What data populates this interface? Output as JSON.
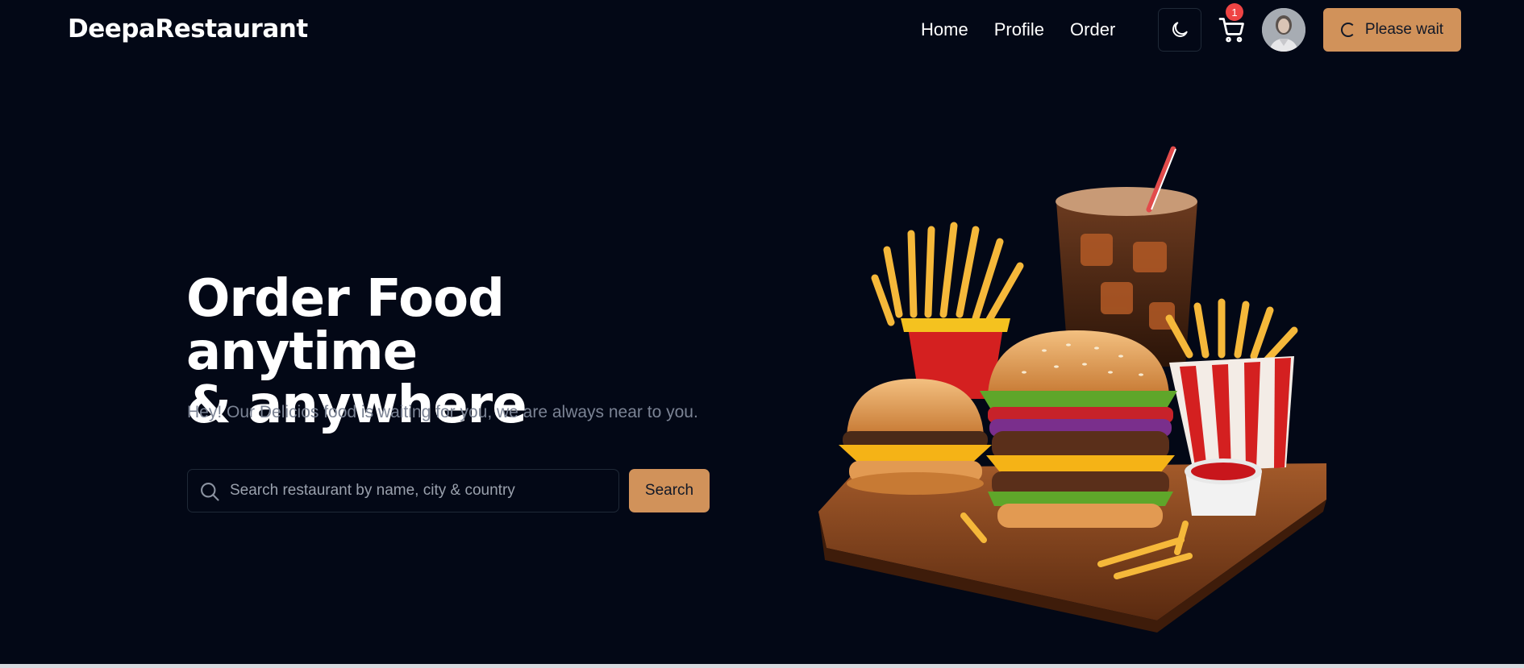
{
  "brand": {
    "name": "DeepaRestaurant"
  },
  "nav": {
    "links": [
      {
        "label": "Home"
      },
      {
        "label": "Profile"
      },
      {
        "label": "Order"
      }
    ],
    "theme_toggle_icon": "moon-icon",
    "cart_icon": "cart-icon",
    "cart_count": "1",
    "avatar_icon": "user-avatar",
    "status_button_label": "Please wait"
  },
  "hero": {
    "title_line1": "Order Food anytime",
    "title_line2": "& anywhere",
    "subtitle": "Hey! Our Delicios food is waiting for you, we are always near to you.",
    "search_placeholder": "Search restaurant by name, city & country",
    "search_value": "",
    "search_button_label": "Search",
    "illustration": "burgers-fries-cola-platter"
  },
  "colors": {
    "background": "#030816",
    "accent": "#d1925a",
    "badge": "#ef4444",
    "muted_text": "#7b8394",
    "border": "#1f2937"
  }
}
